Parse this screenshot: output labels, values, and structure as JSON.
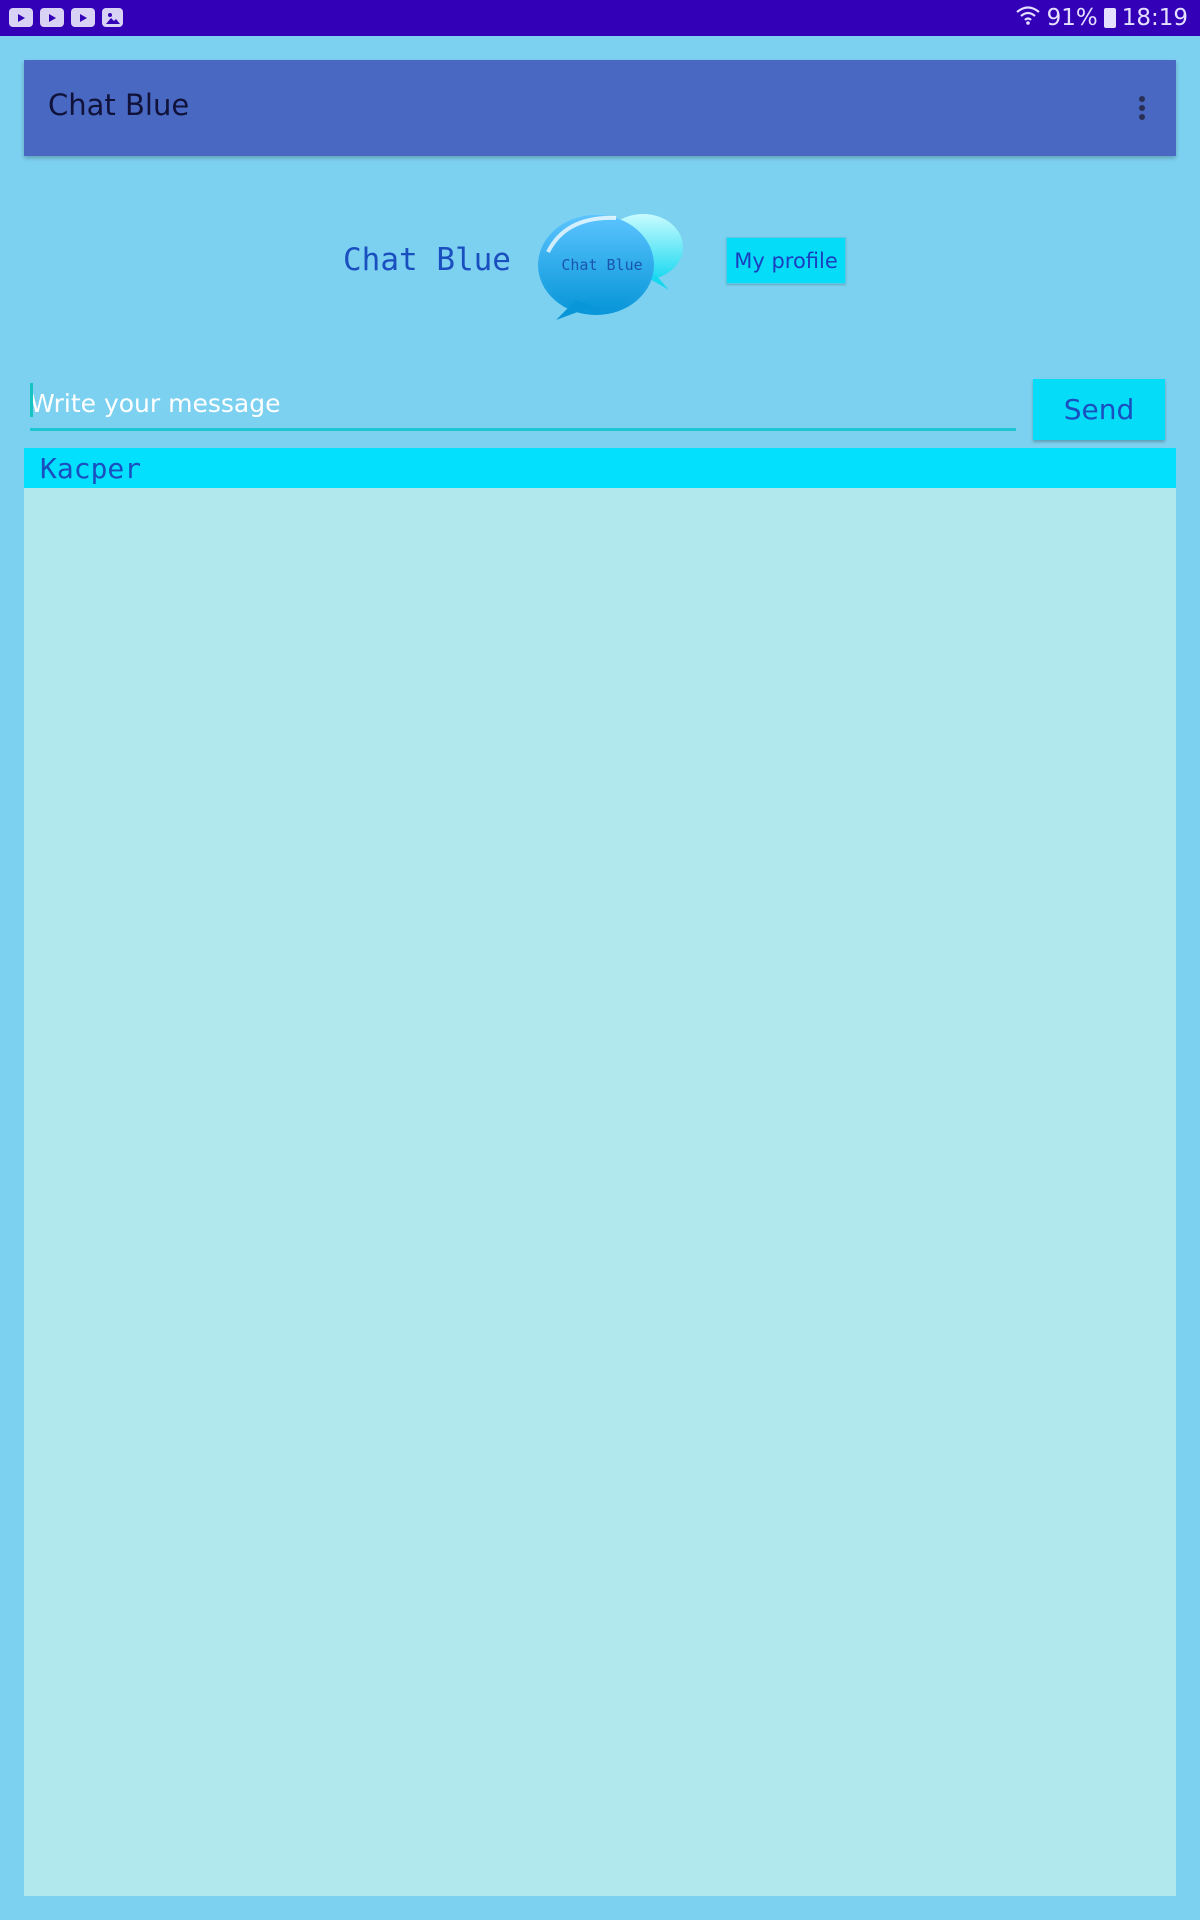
{
  "status_bar": {
    "notifications": [
      "youtube-icon",
      "youtube-icon",
      "youtube-icon",
      "image-icon"
    ],
    "battery": "91%",
    "time": "18:19"
  },
  "app_bar": {
    "title": "Chat Blue"
  },
  "header": {
    "brand": "Chat Blue",
    "logo_text": "Chat Blue",
    "profile_button": "My profile"
  },
  "composer": {
    "placeholder": "Write your message",
    "send_label": "Send"
  },
  "chats": [
    {
      "name": "Kacper"
    }
  ],
  "colors": {
    "status_bar": "#3300b8",
    "app_bar": "#4868c2",
    "background": "#7dd1f0",
    "accent": "#04dcf8",
    "panel": "#b0e8ee",
    "text_blue": "#1a4fc0"
  }
}
